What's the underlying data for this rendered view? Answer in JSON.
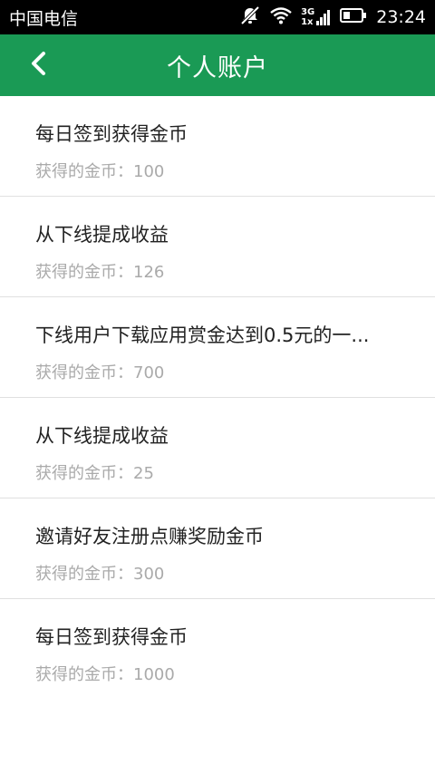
{
  "status_bar": {
    "carrier": "中国电信",
    "network_label": "3G",
    "network_sub": "1x",
    "time": "23:24"
  },
  "header": {
    "title": "个人账户"
  },
  "items": [
    {
      "title": "每日签到获得金币",
      "subtitle": "获得的金币：100"
    },
    {
      "title": "从下线提成收益",
      "subtitle": "获得的金币：126"
    },
    {
      "title": "下线用户下载应用赏金达到0.5元的一...",
      "subtitle": "获得的金币：700"
    },
    {
      "title": "从下线提成收益",
      "subtitle": "获得的金币：25"
    },
    {
      "title": "邀请好友注册点赚奖励金币",
      "subtitle": "获得的金币：300"
    },
    {
      "title": "每日签到获得金币",
      "subtitle": "获得的金币：1000"
    }
  ],
  "colors": {
    "header_bg": "#1a9a55",
    "status_bg": "#000000",
    "subtitle": "#aaaaaa"
  }
}
